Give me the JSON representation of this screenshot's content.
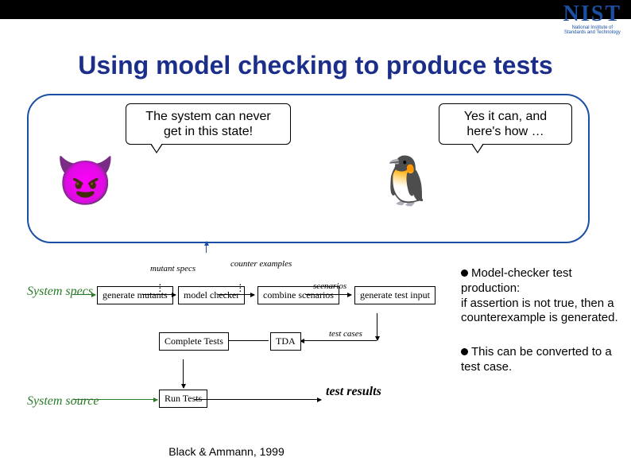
{
  "logo": {
    "big": "NIST",
    "line1": "National Institute of",
    "line2": "Standards and Technology"
  },
  "title": "Using model checking to produce tests",
  "speech": {
    "left": "The system can never\nget in this state!",
    "right": "Yes it can, and\nhere's how …"
  },
  "flow": {
    "system_specs": "System\nspecs",
    "generate_mutants": "generate\nmutants",
    "mutant_specs": "mutant\nspecs",
    "model_checker": "model\nchecker",
    "counter_examples": "counter\nexamples",
    "combine_scenarios": "combine\nscenarios",
    "scenarios": "scenarios",
    "generate_test_input": "generate\ntest input",
    "complete_tests": "Complete\nTests",
    "tda": "TDA",
    "test_cases": "test cases",
    "system_source": "System\nsource",
    "run_tests": "Run\nTests",
    "test_results": "test\nresults"
  },
  "bullets": {
    "b1": "Model-checker test production:\nif assertion is not true, then a counterexample is generated.",
    "b2": "This can be converted to a test case."
  },
  "citation": "Black & Ammann, 1999"
}
